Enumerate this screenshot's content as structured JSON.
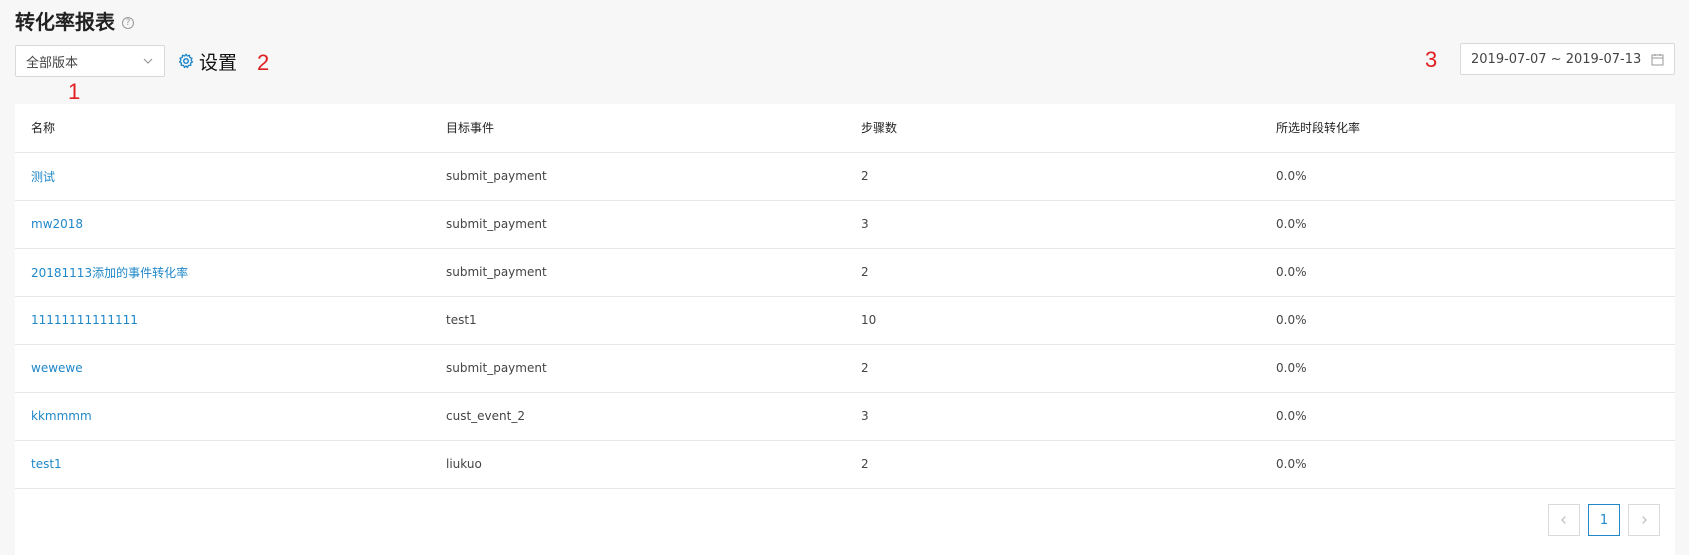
{
  "header": {
    "title": "转化率报表",
    "help_glyph": "?"
  },
  "toolbar": {
    "version_select": {
      "value": "全部版本"
    },
    "settings_label": "设置",
    "date_range": "2019-07-07 ~ 2019-07-13"
  },
  "annotations": [
    "1",
    "2",
    "3"
  ],
  "table": {
    "columns": [
      "名称",
      "目标事件",
      "步骤数",
      "所选时段转化率"
    ],
    "rows": [
      {
        "name": "测试",
        "event": "submit_payment",
        "steps": "2",
        "rate": "0.0%"
      },
      {
        "name": "mw2018",
        "event": "submit_payment",
        "steps": "3",
        "rate": "0.0%"
      },
      {
        "name": "20181113添加的事件转化率",
        "event": "submit_payment",
        "steps": "2",
        "rate": "0.0%"
      },
      {
        "name": "11111111111111",
        "event": "test1",
        "steps": "10",
        "rate": "0.0%"
      },
      {
        "name": "wewewe",
        "event": "submit_payment",
        "steps": "2",
        "rate": "0.0%"
      },
      {
        "name": "kkmmmm",
        "event": "cust_event_2",
        "steps": "3",
        "rate": "0.0%"
      },
      {
        "name": "test1",
        "event": "liukuo",
        "steps": "2",
        "rate": "0.0%"
      }
    ]
  },
  "pagination": {
    "current_page": "1"
  },
  "colors": {
    "link": "#1f87c9",
    "annotation": "#e02020",
    "border": "#d9d9d9"
  },
  "icons": {
    "help": "help-icon",
    "chevron": "chevron-down-icon",
    "settings": "gear-icon",
    "calendar": "calendar-icon",
    "prev": "chevron-left-icon",
    "next": "chevron-right-icon"
  }
}
